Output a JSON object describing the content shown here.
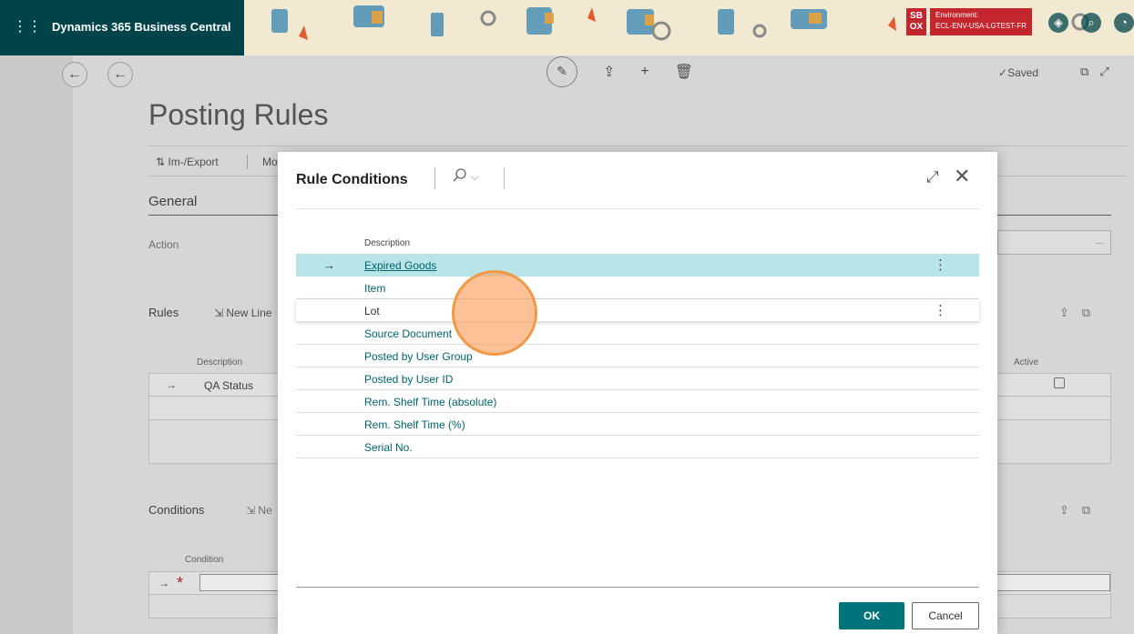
{
  "header": {
    "app_title": "Dynamics 365 Business Central",
    "environment_badge_line1": "SB",
    "environment_badge_line2": "OX",
    "environment_label": "Environment:",
    "environment_name": "ECL-ENV-USA-LGTEST-FR"
  },
  "page": {
    "title": "Posting Rules",
    "saved_label": "Saved",
    "action_bar": {
      "im_export": "Im-/Export",
      "more_truncated": "Mo"
    },
    "general": {
      "section_title": "General",
      "action_label": "Action",
      "action_value_dots": "..."
    },
    "rules": {
      "section_title": "Rules",
      "new_line": "New Line",
      "col_description": "Description",
      "col_active": "Active",
      "row1_description": "QA Status"
    },
    "conditions": {
      "section_title": "Conditions",
      "new_truncated": "Ne",
      "col_condition": "Condition",
      "required_marker": "*"
    }
  },
  "dialog": {
    "title": "Rule Conditions",
    "column_header": "Description",
    "rows": [
      {
        "label": "Expired Goods",
        "selected": true
      },
      {
        "label": "Item"
      },
      {
        "label": "Lot"
      },
      {
        "label": "Source Document"
      },
      {
        "label": "Posted by User Group"
      },
      {
        "label": "Posted by User ID"
      },
      {
        "label": "Rem. Shelf Time (absolute)"
      },
      {
        "label": "Rem. Shelf Time (%)"
      },
      {
        "label": "Serial No."
      }
    ],
    "ok_label": "OK",
    "cancel_label": "Cancel"
  },
  "icons": {
    "waffle": "waffle-icon",
    "back": "back-arrow-icon",
    "edit": "pencil-icon",
    "share": "share-icon",
    "add": "plus-icon",
    "delete": "trash-icon",
    "search": "search-icon",
    "expand": "expand-icon",
    "close": "close-icon",
    "row_arrow": "row-arrow-icon",
    "row_menu": "more-vertical-icon"
  },
  "colors": {
    "brand_bar": "#00444a",
    "accent": "#00737b",
    "selected_row": "#b9e4e8",
    "link_text": "#00646d",
    "required": "#c4262e"
  }
}
